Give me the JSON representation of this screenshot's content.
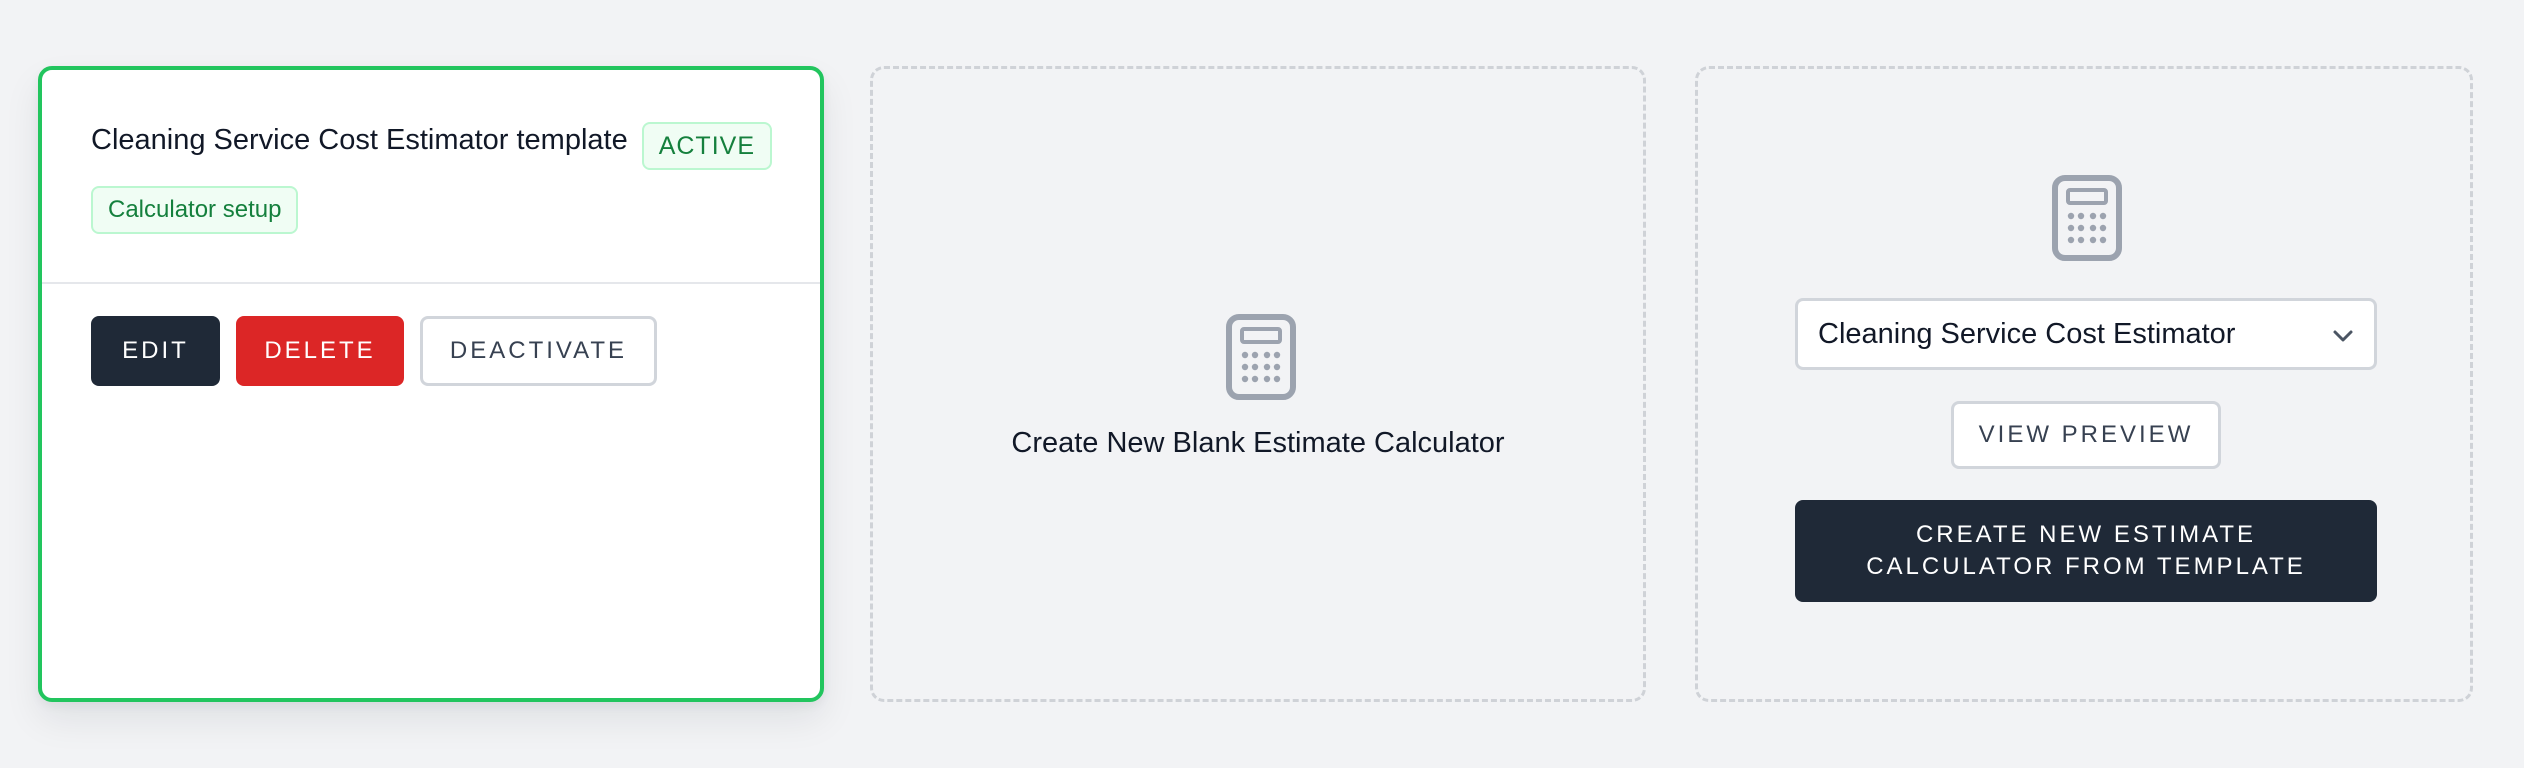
{
  "active_card": {
    "title": "Cleaning Service Cost Estimator template",
    "status_badge": "ACTIVE",
    "tag": "Calculator setup",
    "actions": {
      "edit": "EDIT",
      "delete": "DELETE",
      "deactivate": "DEACTIVATE"
    }
  },
  "blank_card": {
    "icon": "calculator-icon",
    "label": "Create New Blank Estimate Calculator"
  },
  "template_card": {
    "icon": "calculator-icon",
    "selected_template": "Cleaning Service Cost Estimator",
    "preview_label": "VIEW PREVIEW",
    "create_label": "CREATE NEW ESTIMATE CALCULATOR FROM TEMPLATE"
  },
  "colors": {
    "active_border": "#22c55e",
    "badge_text": "#15803d",
    "primary_dark": "#1f2937",
    "danger": "#dc2626",
    "page_bg": "#f2f3f5"
  }
}
